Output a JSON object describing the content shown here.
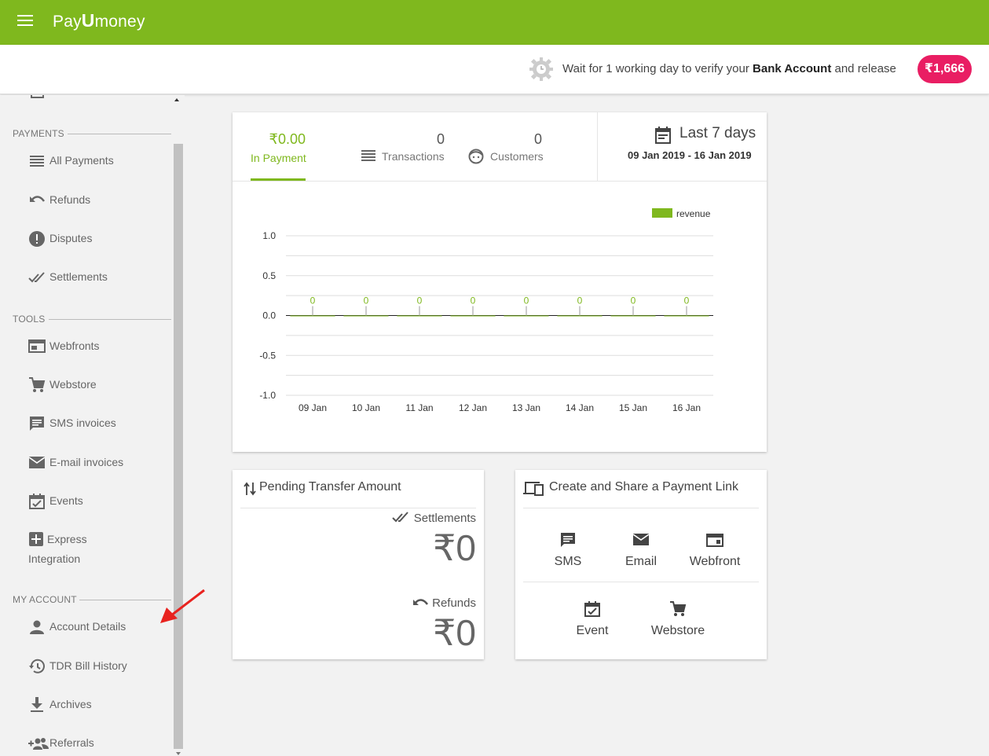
{
  "header": {
    "brand": "PayUmoney",
    "brand_parts": [
      "Pay",
      "U",
      "money"
    ]
  },
  "notice": {
    "text_before": "Wait for 1 working day to verify your ",
    "text_bold": "Bank Account",
    "text_after": " and release",
    "amount": "₹1,666"
  },
  "sidebar": {
    "payments_head": "PAYMENTS",
    "tools_head": "TOOLS",
    "account_head": "MY ACCOUNT",
    "items": {
      "all_payments": "All Payments",
      "refunds": "Refunds",
      "disputes": "Disputes",
      "settlements": "Settlements",
      "webfronts": "Webfronts",
      "webstore": "Webstore",
      "sms_invoices": "SMS invoices",
      "email_invoices": "E-mail invoices",
      "events": "Events",
      "express_1": "Express",
      "express_2": "Integration",
      "account_details": "Account Details",
      "tdr_bill": "TDR Bill History",
      "archives": "Archives",
      "referrals": "Referrals"
    }
  },
  "summary": {
    "payment_value": "₹0.00",
    "payment_label": "In Payment",
    "transactions_value": "0",
    "transactions_label": "Transactions",
    "customers_value": "0",
    "customers_label": "Customers",
    "range_title": "Last 7 days",
    "range_dates": "09 Jan 2019 - 16 Jan 2019"
  },
  "chart_data": {
    "type": "bar",
    "categories": [
      "09 Jan",
      "10 Jan",
      "11 Jan",
      "12 Jan",
      "13 Jan",
      "14 Jan",
      "15 Jan",
      "16 Jan"
    ],
    "series": [
      {
        "name": "revenue",
        "values": [
          0,
          0,
          0,
          0,
          0,
          0,
          0,
          0
        ]
      }
    ],
    "data_labels": [
      "0",
      "0",
      "0",
      "0",
      "0",
      "0",
      "0",
      "0"
    ],
    "y_ticks": [
      "1.0",
      "0.5",
      "0.0",
      "-0.5",
      "-1.0"
    ],
    "ylim": [
      -1.0,
      1.0
    ],
    "legend_position": "top-right",
    "grid": true,
    "color": "#7fb81e"
  },
  "pending": {
    "title": "Pending Transfer Amount",
    "settlements_label": "Settlements",
    "settlements_value": "₹0",
    "refunds_label": "Refunds",
    "refunds_value": "₹0"
  },
  "share": {
    "title": "Create and Share a Payment Link",
    "sms": "SMS",
    "email": "Email",
    "webfront": "Webfront",
    "event": "Event",
    "webstore": "Webstore"
  },
  "colors": {
    "brand_green": "#7fb81e",
    "pill_pink": "#e91e63"
  }
}
